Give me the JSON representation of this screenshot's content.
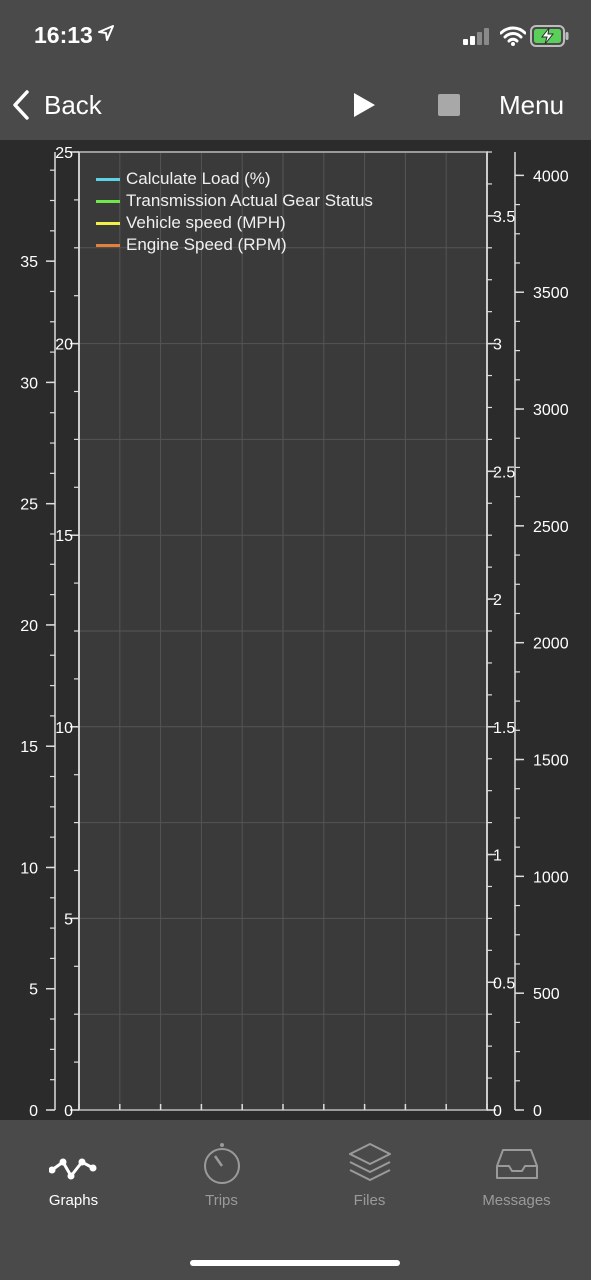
{
  "status_bar": {
    "time": "16:13"
  },
  "nav": {
    "back_label": "Back",
    "menu_label": "Menu"
  },
  "legend": [
    {
      "label": "Calculate Load (%)",
      "color": "#5fd3e6"
    },
    {
      "label": "Transmission Actual Gear Status",
      "color": "#6ee84b"
    },
    {
      "label": "Vehicle speed (MPH)",
      "color": "#f3f04a"
    },
    {
      "label": "Engine Speed (RPM)",
      "color": "#e5803a"
    }
  ],
  "chart_data": {
    "type": "line",
    "series": [
      {
        "name": "Calculate Load (%)",
        "values": []
      },
      {
        "name": "Transmission Actual Gear Status",
        "values": []
      },
      {
        "name": "Vehicle speed (MPH)",
        "values": []
      },
      {
        "name": "Engine Speed (RPM)",
        "values": []
      }
    ],
    "x_axis": {
      "range": [
        0,
        100
      ],
      "ticks": [
        "0",
        "50",
        "100"
      ]
    },
    "y_axes": [
      {
        "range": [
          0,
          39.5
        ],
        "ticks": [
          "0",
          "5",
          "10",
          "15",
          "20",
          "25",
          "30",
          "35"
        ]
      },
      {
        "range": [
          0,
          25
        ],
        "ticks": [
          "0",
          "5",
          "10",
          "15",
          "20",
          "25"
        ]
      },
      {
        "range": [
          0,
          3.75
        ],
        "ticks": [
          "0",
          "0.5",
          "1",
          "1.5",
          "2",
          "2.5",
          "3",
          "3.5"
        ]
      },
      {
        "range": [
          0,
          4100
        ],
        "ticks": [
          "0",
          "500",
          "1000",
          "1500",
          "2000",
          "2500",
          "3000",
          "3500",
          "4000"
        ]
      }
    ],
    "grid": true
  },
  "tabs": [
    {
      "label": "Graphs",
      "icon": "graph-icon",
      "active": true
    },
    {
      "label": "Trips",
      "icon": "speedometer-icon",
      "active": false
    },
    {
      "label": "Files",
      "icon": "stack-icon",
      "active": false
    },
    {
      "label": "Messages",
      "icon": "inbox-icon",
      "active": false
    }
  ]
}
